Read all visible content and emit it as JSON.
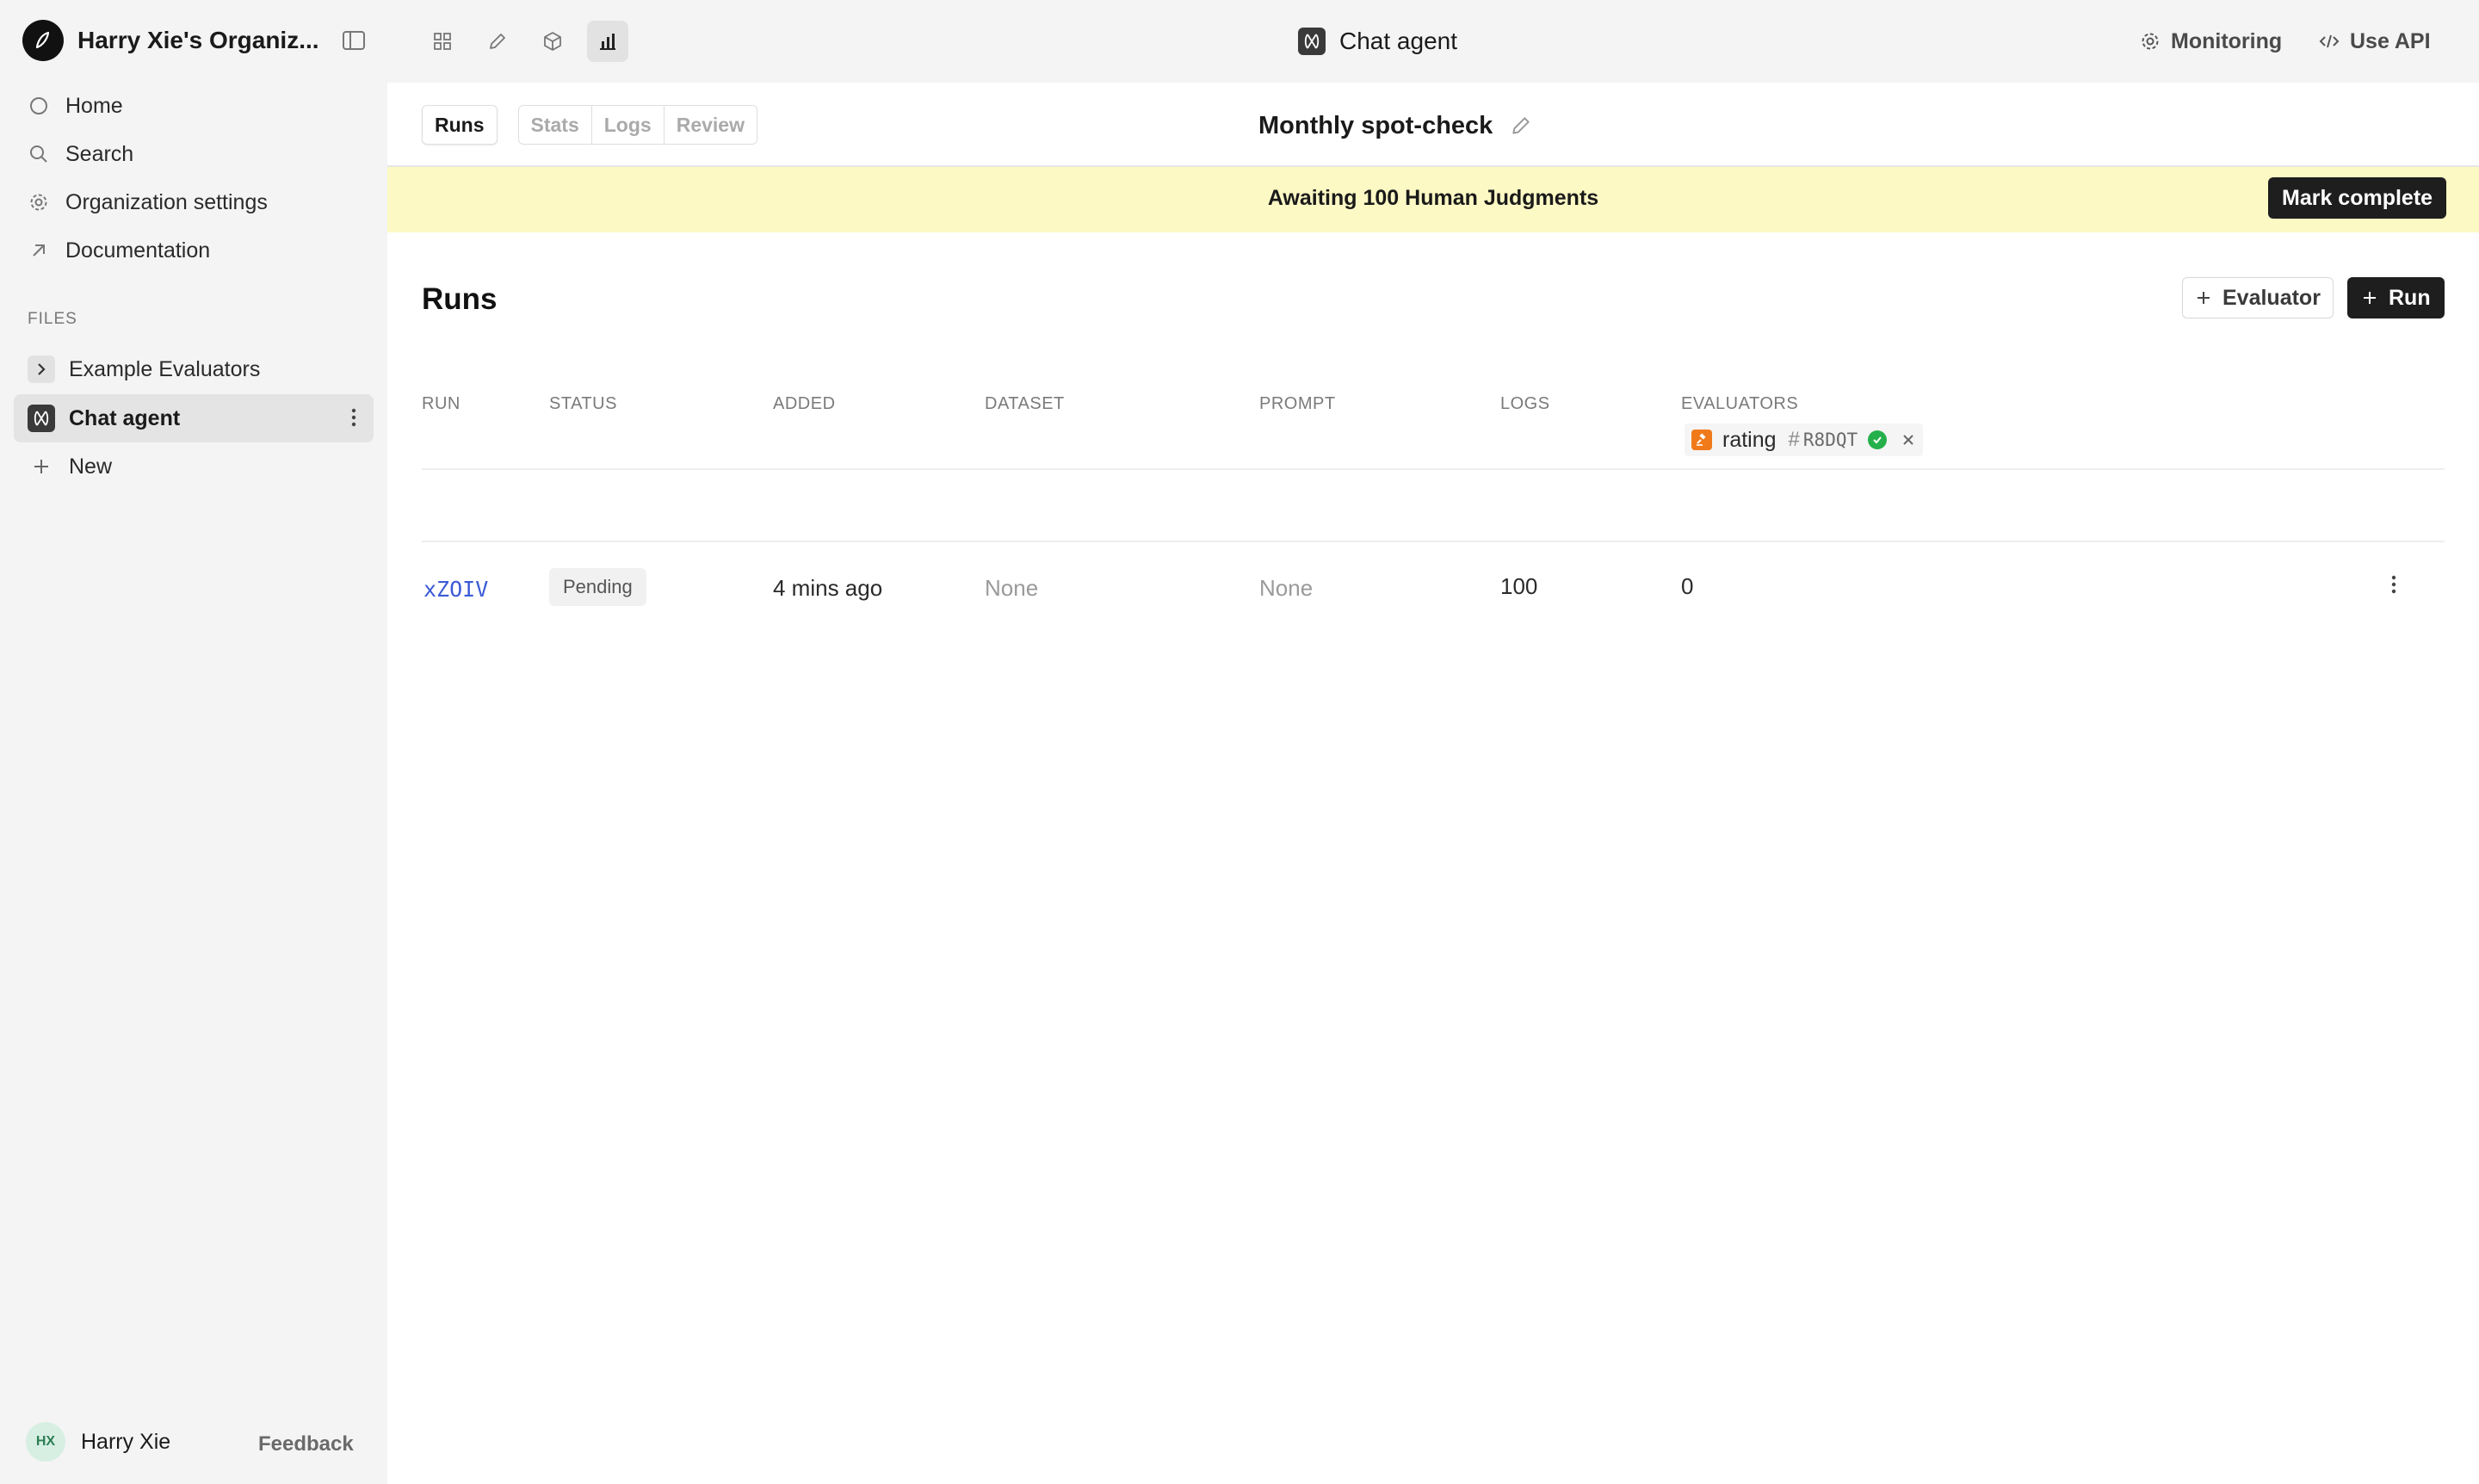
{
  "sidebar": {
    "org_name": "Harry Xie's Organiz...",
    "nav": [
      {
        "label": "Home",
        "icon": "circle-icon"
      },
      {
        "label": "Search",
        "icon": "search-icon"
      },
      {
        "label": "Organization settings",
        "icon": "gear-icon"
      },
      {
        "label": "Documentation",
        "icon": "arrow-up-right-icon"
      }
    ],
    "files_heading": "FILES",
    "files": [
      {
        "label": "Example Evaluators",
        "icon": "chevron-right-icon"
      },
      {
        "label": "Chat agent",
        "icon": "agent-icon",
        "active": true
      },
      {
        "label": "New",
        "icon": "plus-icon"
      }
    ],
    "user": {
      "initials": "HX",
      "name": "Harry Xie"
    },
    "feedback_label": "Feedback"
  },
  "topbar": {
    "title": "Chat agent",
    "monitoring_label": "Monitoring",
    "use_api_label": "Use API"
  },
  "main": {
    "tabs": {
      "runs": "Runs",
      "stats": "Stats",
      "logs": "Logs",
      "review": "Review"
    },
    "page_title": "Monthly spot-check",
    "banner": {
      "text": "Awaiting 100 Human Judgments",
      "button": "Mark complete",
      "color": "#fdf9c4"
    },
    "section_title": "Runs",
    "evaluator_button": "Evaluator",
    "run_button": "Run",
    "table": {
      "headers": {
        "run": "RUN",
        "status": "STATUS",
        "added": "ADDED",
        "dataset": "DATASET",
        "prompt": "PROMPT",
        "logs": "LOGS",
        "evaluators": "EVALUATORS"
      },
      "evaluator": {
        "name": "rating",
        "hash": "#",
        "version": "R8DQT"
      },
      "rows": [
        {
          "run": "xZOIV",
          "status": "Pending",
          "added": "4 mins ago",
          "dataset": "None",
          "prompt": "None",
          "logs": "100",
          "evaluators": "0"
        }
      ]
    },
    "link_color": "#3b5bd6"
  }
}
